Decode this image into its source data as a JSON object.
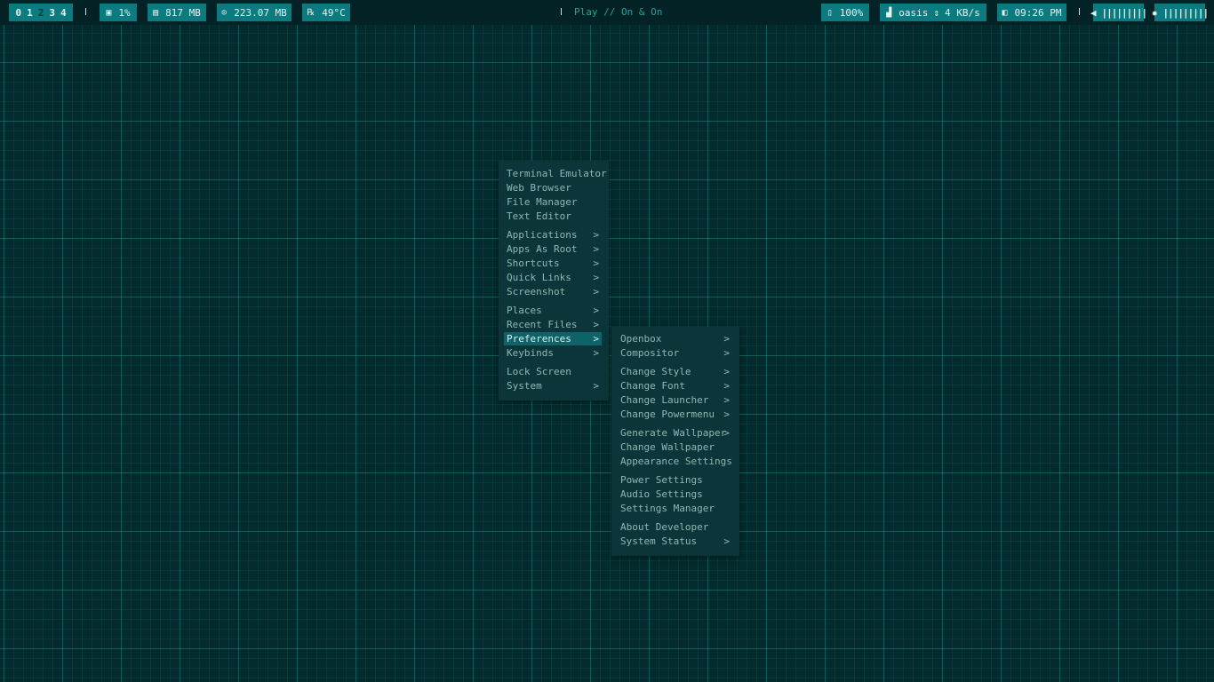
{
  "topbar": {
    "workspaces": [
      "0",
      "1",
      "2",
      "3",
      "4"
    ],
    "active_workspace": "2",
    "cpu": {
      "icon": "cpu-icon",
      "value": "1%"
    },
    "memory": {
      "icon": "memory-icon",
      "value": "817 MB"
    },
    "disk": {
      "icon": "disk-icon",
      "value": "223.07 MB"
    },
    "temperature": {
      "icon": "thermometer-icon",
      "value": "49°C"
    },
    "media": {
      "text": "Play // On & On"
    },
    "battery": {
      "icon": "battery-icon",
      "value": "100%"
    },
    "network": {
      "icon": "signal-icon",
      "ssid": "oasis",
      "speed_icon": "up-down-arrows-icon",
      "speed": "4 KB/s"
    },
    "clock": {
      "icon": "clock-icon",
      "value": "09:26 PM"
    },
    "volume": {
      "icon": "speaker-icon",
      "bars": "|||||||||"
    },
    "brightness": {
      "icon": "brightness-icon",
      "bars": "|||||||||"
    }
  },
  "main_menu": {
    "items": [
      {
        "label": "Terminal Emulator",
        "submenu": false
      },
      {
        "label": "Web Browser",
        "submenu": false
      },
      {
        "label": "File Manager",
        "submenu": false
      },
      {
        "label": "Text Editor",
        "submenu": false
      },
      {
        "label": "Applications",
        "submenu": true
      },
      {
        "label": "Apps As Root",
        "submenu": true
      },
      {
        "label": "Shortcuts",
        "submenu": true
      },
      {
        "label": "Quick Links",
        "submenu": true
      },
      {
        "label": "Screenshot",
        "submenu": true
      },
      {
        "label": "Places",
        "submenu": true
      },
      {
        "label": "Recent Files",
        "submenu": true
      },
      {
        "label": "Preferences",
        "submenu": true,
        "selected": true
      },
      {
        "label": "Keybinds",
        "submenu": true
      },
      {
        "label": "Lock Screen",
        "submenu": false
      },
      {
        "label": "System",
        "submenu": true
      }
    ]
  },
  "preferences_menu": {
    "items": [
      {
        "label": "Openbox",
        "submenu": true
      },
      {
        "label": "Compositor",
        "submenu": true
      },
      {
        "label": "Change Style",
        "submenu": true
      },
      {
        "label": "Change Font",
        "submenu": true
      },
      {
        "label": "Change Launcher",
        "submenu": true
      },
      {
        "label": "Change Powermenu",
        "submenu": true
      },
      {
        "label": "Generate Wallpaper",
        "submenu": true
      },
      {
        "label": "Change Wallpaper",
        "submenu": false
      },
      {
        "label": "Appearance Settings",
        "submenu": false
      },
      {
        "label": "Power Settings",
        "submenu": false
      },
      {
        "label": "Audio Settings",
        "submenu": false
      },
      {
        "label": "Settings Manager",
        "submenu": false
      },
      {
        "label": "About Developer",
        "submenu": false
      },
      {
        "label": "System Status",
        "submenu": true
      }
    ]
  },
  "colors": {
    "background": "#032a2c",
    "bar_background": "#022225",
    "module": "#0c7b7f",
    "menu": "#0b3538",
    "menu_selected": "#0f6268",
    "menu_text": "#8fb8b4"
  }
}
